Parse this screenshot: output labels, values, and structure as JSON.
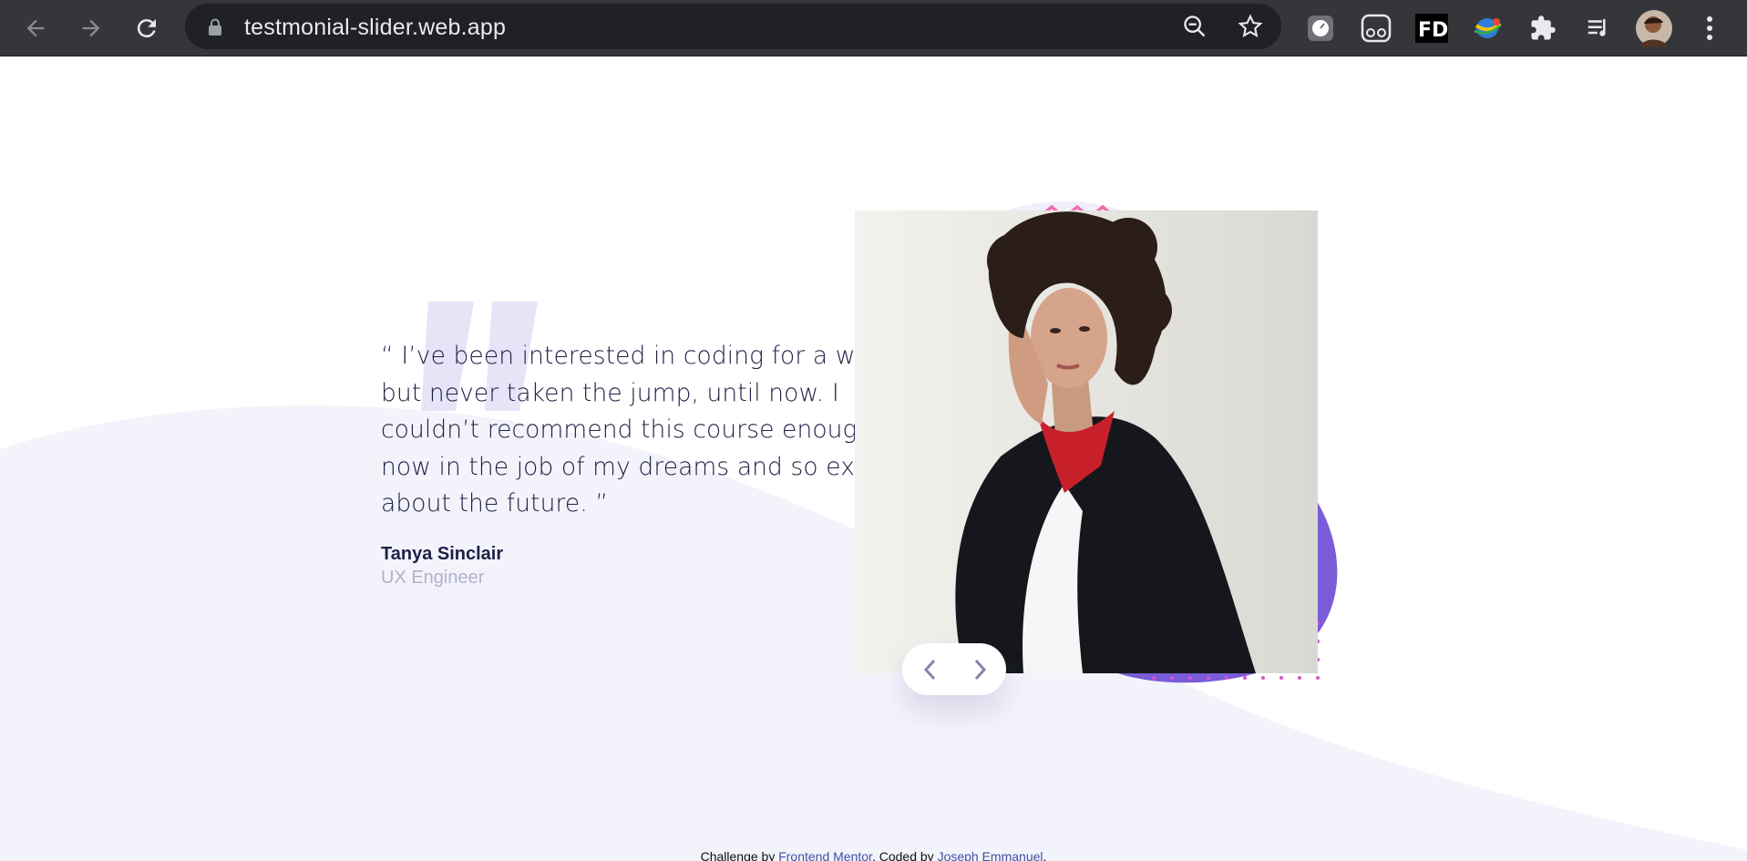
{
  "browser": {
    "url": "testmonial-slider.web.app",
    "back_icon": "arrow-left-icon",
    "forward_icon": "arrow-right-icon",
    "reload_icon": "reload-icon"
  },
  "testimonial": {
    "quote": "“ I’ve been interested in coding for a while but never taken the jump, until now. I couldn’t recommend this course enough. I’m now in the job of my dreams and so excited about the future. ”",
    "name": "Tanya Sinclair",
    "role": "UX Engineer"
  },
  "footer": {
    "prefix": "Challenge by ",
    "link1": "Frontend Mentor",
    "middle": ". Coded by ",
    "link2": "Joseph Emmanuel",
    "suffix": "."
  },
  "colors": {
    "accent_purple": "#6d55e0",
    "dark_navy": "#202047",
    "muted_text": "#b1b1cc",
    "page_bg_curve": "#f3f3fb"
  }
}
